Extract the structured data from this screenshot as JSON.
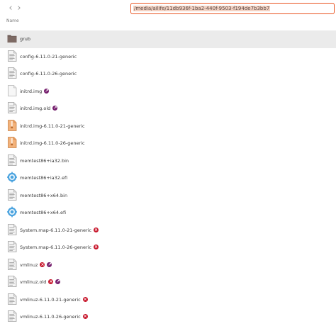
{
  "toolbar": {
    "back_glyph": "‹",
    "forward_glyph": "›",
    "path_value": "/media/ailife/11db936f-1ba2-440f-9503-f194de7b3bb7"
  },
  "header": {
    "name_label": "Name"
  },
  "colors": {
    "accent": "#e95420",
    "unreadable": "#c7162b",
    "symlink": "#77216f"
  },
  "files": [
    {
      "name": "grub",
      "icon": "folder-icon",
      "emblems": []
    },
    {
      "name": "config-6.11.0-21-generic",
      "icon": "text-file-icon",
      "emblems": []
    },
    {
      "name": "config-6.11.0-26-generic",
      "icon": "text-file-icon",
      "emblems": []
    },
    {
      "name": "initrd.img",
      "icon": "blank-file-icon",
      "emblems": [
        "link"
      ]
    },
    {
      "name": "initrd.img.old",
      "icon": "text-file-icon",
      "emblems": [
        "link"
      ]
    },
    {
      "name": "initrd.img-6.11.0-21-generic",
      "icon": "archive-file-icon",
      "emblems": []
    },
    {
      "name": "initrd.img-6.11.0-26-generic",
      "icon": "archive-file-icon",
      "emblems": []
    },
    {
      "name": "memtest86+ia32.bin",
      "icon": "text-file-icon",
      "emblems": []
    },
    {
      "name": "memtest86+ia32.efi",
      "icon": "executable-icon",
      "emblems": []
    },
    {
      "name": "memtest86+x64.bin",
      "icon": "text-file-icon",
      "emblems": []
    },
    {
      "name": "memtest86+x64.efi",
      "icon": "executable-icon",
      "emblems": []
    },
    {
      "name": "System.map-6.11.0-21-generic",
      "icon": "text-file-icon",
      "emblems": [
        "unreadable"
      ]
    },
    {
      "name": "System.map-6.11.0-26-generic",
      "icon": "text-file-icon",
      "emblems": [
        "unreadable"
      ]
    },
    {
      "name": "vmlinuz",
      "icon": "text-file-icon",
      "emblems": [
        "unreadable",
        "link"
      ]
    },
    {
      "name": "vmlinuz.old",
      "icon": "text-file-icon",
      "emblems": [
        "unreadable",
        "link"
      ]
    },
    {
      "name": "vmlinuz-6.11.0-21-generic",
      "icon": "text-file-icon",
      "emblems": [
        "unreadable"
      ]
    },
    {
      "name": "vmlinuz-6.11.0-26-generic",
      "icon": "text-file-icon",
      "emblems": [
        "unreadable"
      ]
    }
  ]
}
